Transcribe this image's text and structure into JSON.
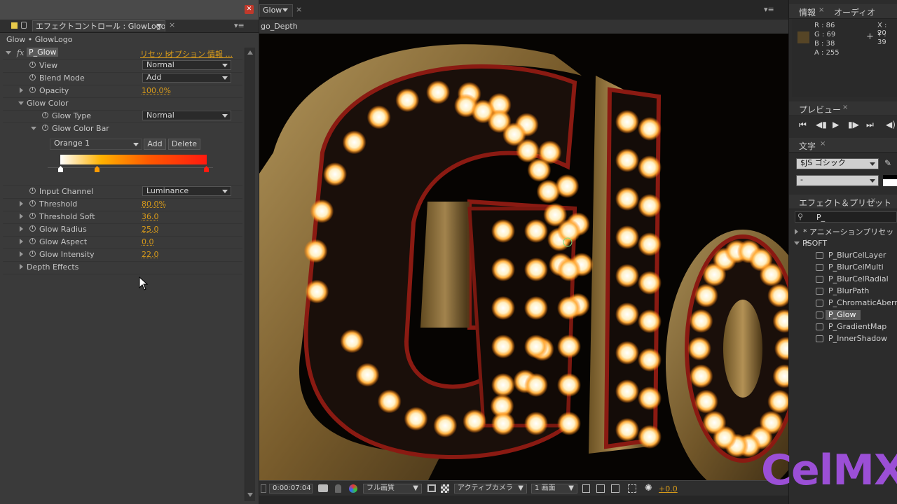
{
  "effect_controls": {
    "tab_title": "エフェクトコントロール : GlowLogo",
    "breadcrumb": "Glow • GlowLogo",
    "fx_icon": "fx",
    "effect_name": "P_Glow",
    "links": [
      "リセット",
      "オプション ...",
      "情報 ..."
    ],
    "rows": [
      {
        "label": "View",
        "control": "Normal"
      },
      {
        "label": "Blend Mode",
        "control": "Add"
      },
      {
        "label": "Opacity",
        "value": "100.0%"
      },
      {
        "label": "Glow Color"
      },
      {
        "label": "Glow Type",
        "control": "Normal"
      },
      {
        "label": "Glow Color Bar"
      },
      {
        "label": "Input Channel",
        "control": "Luminance"
      },
      {
        "label": "Threshold",
        "value": "80.0%"
      },
      {
        "label": "Threshold Soft",
        "value": "36.0"
      },
      {
        "label": "Glow Radius",
        "value": "25.0"
      },
      {
        "label": "Glow Aspect",
        "value": "0.0"
      },
      {
        "label": "Glow Intensity",
        "value": "22.0"
      },
      {
        "label": "Depth Effects"
      }
    ],
    "color_preset": "Orange 1",
    "add_label": "Add",
    "delete_label": "Delete",
    "gradient_colors": [
      "#ffffff",
      "#ffb200",
      "#ff5a00",
      "#ff1a10"
    ]
  },
  "composition": {
    "tab_label": "Glow",
    "sub_label": "go_Depth",
    "timecode": "0:00:07:04",
    "resolution": "フル画質",
    "camera": "アクティブカメラ",
    "views": "1 画面",
    "exposure": "+0.0"
  },
  "info_panel": {
    "tabs": [
      "情報",
      "オーディオ"
    ],
    "r": "R : 86",
    "g": "G : 69",
    "b": "B : 38",
    "a": "A : 255",
    "x": "X : 20",
    "y": "Y : 39",
    "swatch": "#564526"
  },
  "preview_panel": {
    "title": "プレビュー"
  },
  "character_panel": {
    "title": "文字",
    "font": "$JS ゴシック",
    "style": "-"
  },
  "effects_presets": {
    "title": "エフェクト＆プリセット",
    "search": "P_",
    "groups": [
      "* アニメーションプリセット",
      "PSOFT"
    ],
    "items": [
      "P_BlurCelLayer",
      "P_BlurCelMulti",
      "P_BlurCelRadial",
      "P_BlurPath",
      "P_ChromaticAberrat",
      "P_Glow",
      "P_GradientMap",
      "P_InnerShadow"
    ],
    "selected": "P_Glow"
  },
  "watermark": "CelMX"
}
